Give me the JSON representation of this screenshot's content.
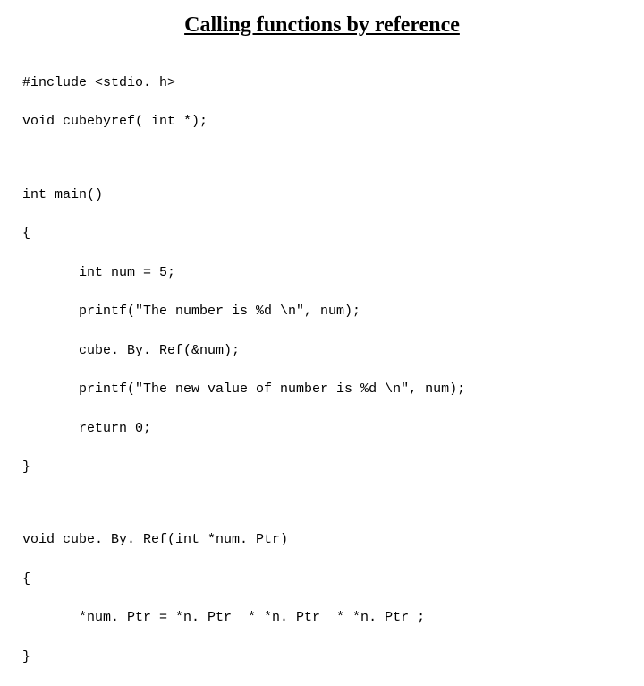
{
  "title": "Calling functions by reference",
  "lines": {
    "l1": "#include <stdio. h>",
    "l2": "void cubebyref( int *);",
    "l3": "int main()",
    "l4": "{",
    "l5": "       int num = 5;",
    "l6": "       printf(\"The number is %d \\n\", num);",
    "l7": "       cube. By. Ref(&num);",
    "l8": "       printf(\"The new value of number is %d \\n\", num);",
    "l9": "       return 0;",
    "l10": "}",
    "l11": "void cube. By. Ref(int *num. Ptr)",
    "l12": "{",
    "l13": "       *num. Ptr = *n. Ptr  * *n. Ptr  * *n. Ptr ;",
    "l14": "}"
  }
}
